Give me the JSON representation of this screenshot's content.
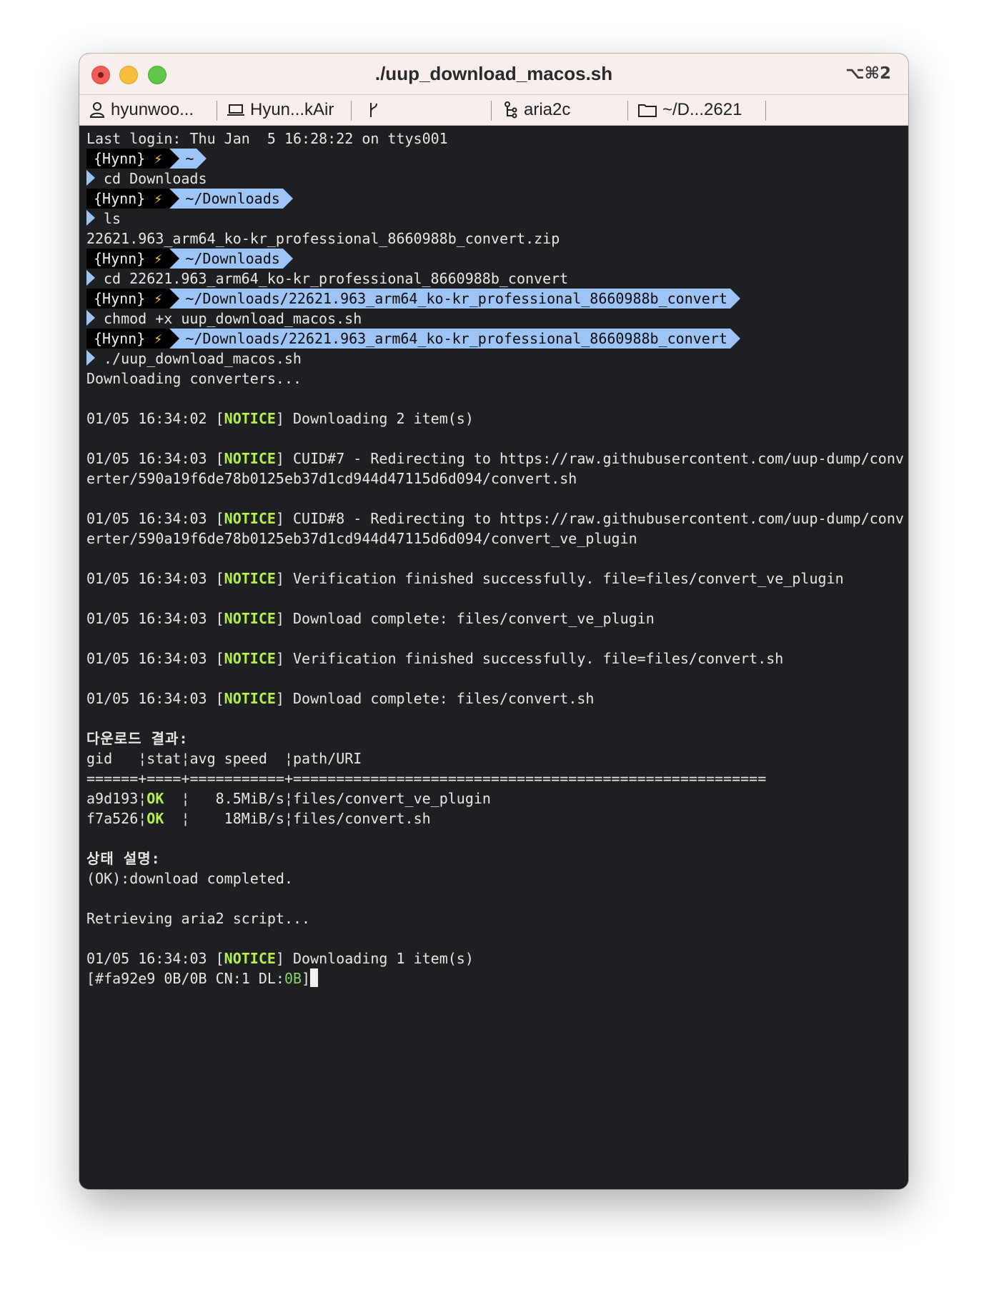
{
  "window": {
    "title": "./uup_download_macos.sh",
    "shortcut": "⌥⌘2"
  },
  "tabs": [
    {
      "label": "hyunwoo...",
      "icon": "person-icon"
    },
    {
      "label": "Hyun...kAir",
      "icon": "laptop-icon"
    },
    {
      "label": "",
      "icon": "git-branch-icon"
    },
    {
      "label": "aria2c",
      "icon": "process-icon"
    },
    {
      "label": "~/D...2621",
      "icon": "folder-icon"
    }
  ],
  "terminal": {
    "last_login": "Last login: Thu Jan  5 16:28:22 on ttys001",
    "prompt_user": "{Hynn}",
    "prompt_bolt": "⚡",
    "path_home": "~",
    "path_downloads": "~/Downloads",
    "path_convert": "~/Downloads/22621.963_arm64_ko-kr_professional_8660988b_convert",
    "cmd_cd_downloads": "cd Downloads",
    "cmd_ls": "ls",
    "ls_output": "22621.963_arm64_ko-kr_professional_8660988b_convert.zip",
    "cmd_cd_convert": "cd 22621.963_arm64_ko-kr_professional_8660988b_convert",
    "cmd_chmod": "chmod +x uup_download_macos.sh",
    "cmd_run": "./uup_download_macos.sh",
    "downloading_converters": "Downloading converters...",
    "notice_tag": "NOTICE",
    "log": [
      {
        "ts": "01/05 16:34:02",
        "msg": " Downloading 2 item(s)"
      },
      {
        "ts": "01/05 16:34:03",
        "msg": " CUID#7 - Redirecting to https://raw.githubusercontent.com/uup-dump/conv",
        "cont": "erter/590a19f6de78b0125eb37d1cd944d47115d6d094/convert.sh"
      },
      {
        "ts": "01/05 16:34:03",
        "msg": " CUID#8 - Redirecting to https://raw.githubusercontent.com/uup-dump/conv",
        "cont": "erter/590a19f6de78b0125eb37d1cd944d47115d6d094/convert_ve_plugin"
      },
      {
        "ts": "01/05 16:34:03",
        "msg": " Verification finished successfully. file=files/convert_ve_plugin"
      },
      {
        "ts": "01/05 16:34:03",
        "msg": " Download complete: files/convert_ve_plugin"
      },
      {
        "ts": "01/05 16:34:03",
        "msg": " Verification finished successfully. file=files/convert.sh"
      },
      {
        "ts": "01/05 16:34:03",
        "msg": " Download complete: files/convert.sh"
      }
    ],
    "result_heading": "다운로드 결과:",
    "table_header": "gid   ¦stat¦avg speed  ¦path/URI",
    "table_rule": "======+====+===========+=======================================================",
    "rows": [
      {
        "gid": "a9d193",
        "stat": "OK",
        "rest": "  ¦   8.5MiB/s¦files/convert_ve_plugin"
      },
      {
        "gid": "f7a526",
        "stat": "OK",
        "rest": "  ¦    18MiB/s¦files/convert.sh"
      }
    ],
    "status_heading": "상태 설명:",
    "status_ok": "(OK):download completed.",
    "retrieving": "Retrieving aria2 script...",
    "last_log": {
      "ts": "01/05 16:34:03",
      "msg": " Downloading 1 item(s)"
    },
    "progress_prefix": "[#fa92e9 0B/0B CN:1 DL:",
    "progress_dl": "0B",
    "progress_suffix": "]"
  },
  "colors": {
    "notice": "#b6ef4a",
    "path_segment": "#9ec4f6",
    "terminal_bg": "#1e1f22",
    "titlebar_bg": "#f8eeec"
  }
}
